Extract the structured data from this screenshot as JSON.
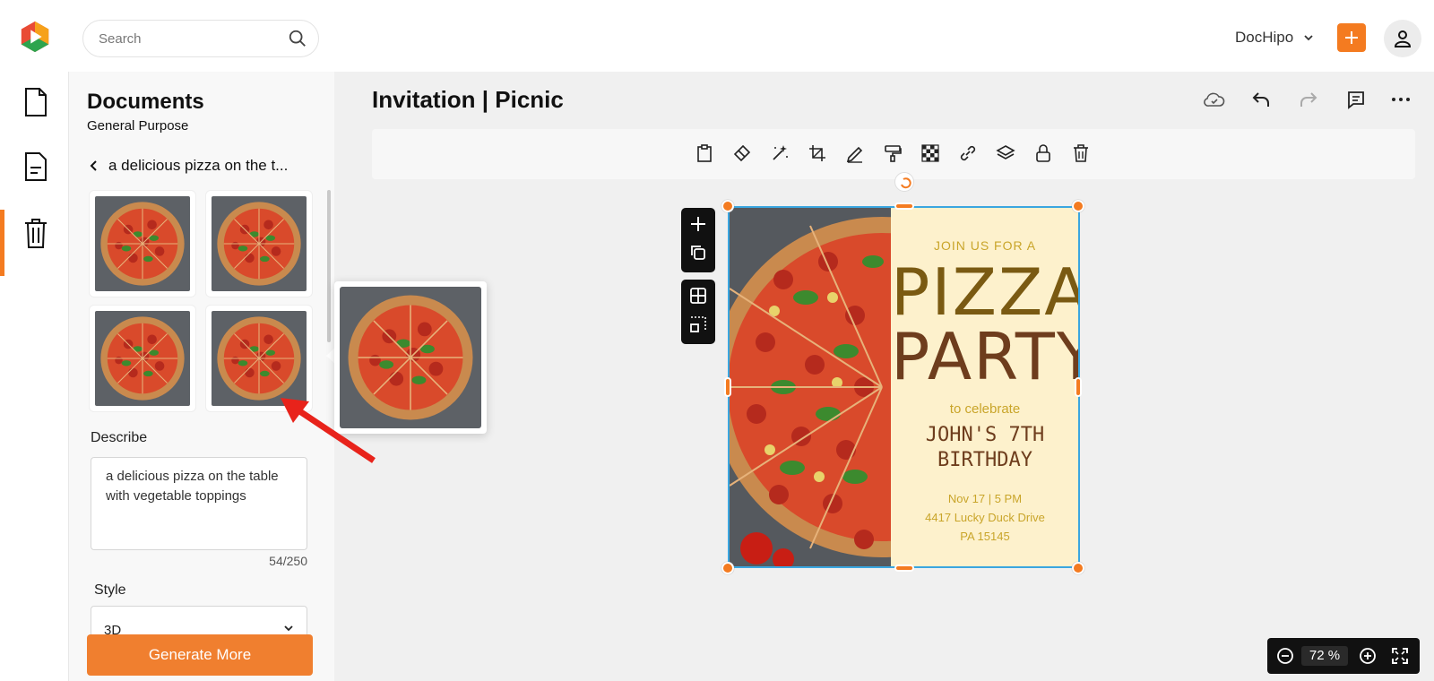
{
  "search": {
    "placeholder": "Search"
  },
  "header": {
    "account": "DocHipo"
  },
  "panel": {
    "title": "Documents",
    "subtitle": "General Purpose",
    "query": "a delicious pizza on the t...",
    "describe_label": "Describe",
    "describe_value": "a delicious pizza on the table with vegetable toppings",
    "counter": "54/250",
    "style_label": "Style",
    "style_value": "3D",
    "generate_label": "Generate More"
  },
  "document": {
    "title": "Invitation | Picnic"
  },
  "card": {
    "join": "JOIN US FOR A",
    "pizza": "PIZZA",
    "party": "PARTY",
    "celebrate": "to celebrate",
    "name_line1": "JOHN'S 7TH",
    "name_line2": "BIRTHDAY",
    "date": "Nov 17 | 5 PM",
    "address1": "4417 Lucky Duck Drive",
    "address2": "PA 15145"
  },
  "zoom": {
    "value": "72 %"
  },
  "colors": {
    "accent": "#f47b20",
    "selection": "#3aa6e0",
    "card_bg": "#fdf1cc"
  }
}
